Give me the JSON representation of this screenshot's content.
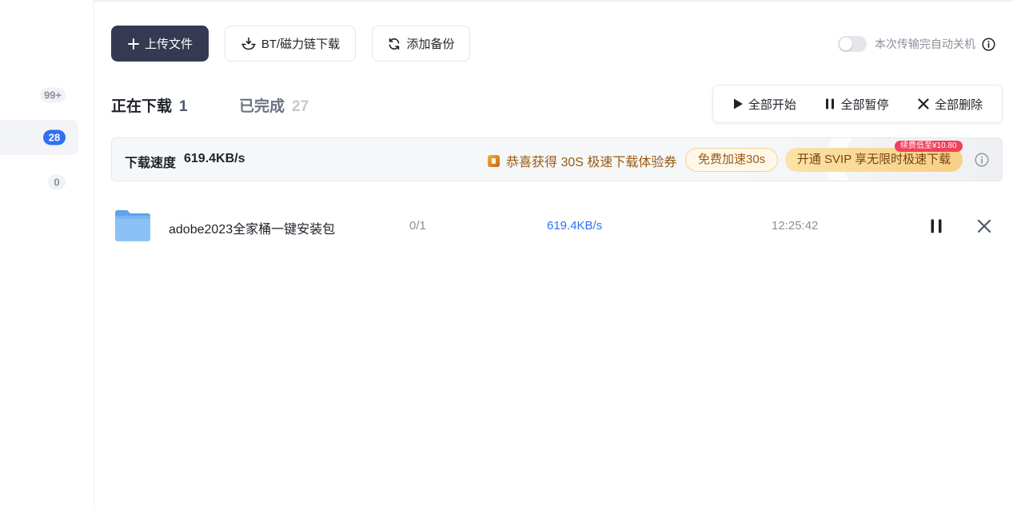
{
  "sidebar": {
    "items": [
      {
        "badge": "99+",
        "active": false
      },
      {
        "badge": "28",
        "active": true
      },
      {
        "badge": "0",
        "active": false
      }
    ]
  },
  "toolbar": {
    "upload_label": "上传文件",
    "bt_label": "BT/磁力链下载",
    "backup_label": "添加备份",
    "auto_shutdown_label": "本次传输完自动关机",
    "auto_shutdown_on": false
  },
  "tabs": [
    {
      "label": "正在下载",
      "count": "1",
      "active": true
    },
    {
      "label": "已完成",
      "count": "27",
      "active": false
    }
  ],
  "bulk_actions": {
    "start_all": "全部开始",
    "pause_all": "全部暂停",
    "delete_all": "全部删除"
  },
  "banner": {
    "speed_label": "下载速度",
    "speed_value": "619.4KB/s",
    "promo_text": "恭喜获得 30S 极速下载体验券",
    "free_accel_label": "免费加速30s",
    "svip_label": "开通 SVIP 享无限时极速下载",
    "svip_tag": "续费低至¥10.80"
  },
  "tasks": [
    {
      "name": "adobe2023全家桶一键安装包",
      "progress": "0/1",
      "speed": "619.4KB/s",
      "time": "12:25:42",
      "icon": "folder-icon"
    }
  ],
  "colors": {
    "primary_button": "#353a52",
    "accent_blue": "#2f6ff3",
    "promo_gold": "#9a5b11",
    "svip_tag_red": "#f0405b"
  }
}
